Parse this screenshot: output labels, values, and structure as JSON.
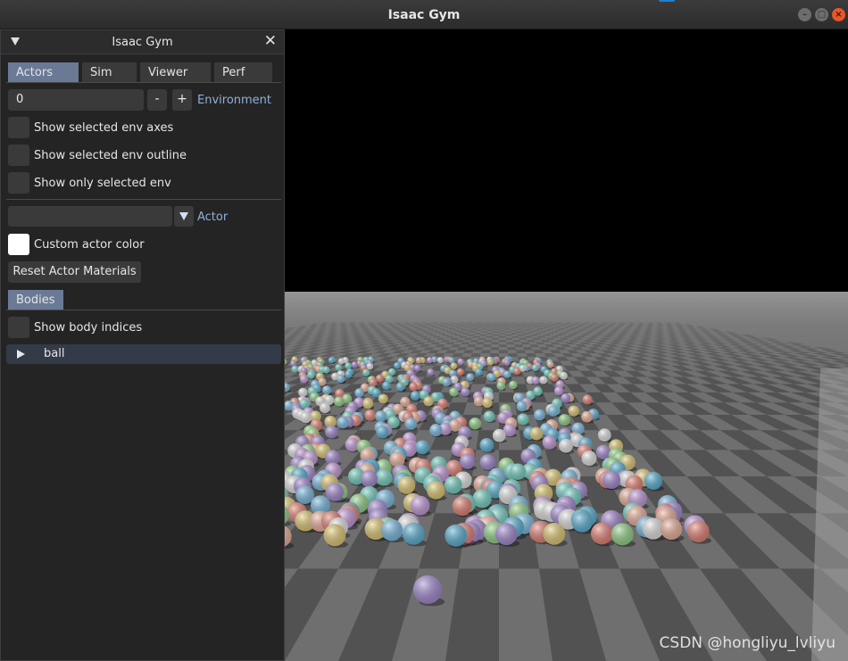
{
  "window": {
    "title": "Isaac Gym"
  },
  "panel": {
    "title": "Isaac Gym",
    "tabs": [
      "Actors",
      "Sim",
      "Viewer",
      "Perf"
    ],
    "environment": {
      "value": "0",
      "minus": "-",
      "plus": "+",
      "label": "Environment"
    },
    "checkboxes": {
      "axes": "Show selected env axes",
      "outline": "Show selected env outline",
      "only": "Show only selected env"
    },
    "actor": {
      "selected": "",
      "label": "Actor"
    },
    "custom_color": "Custom actor color",
    "reset_button": "Reset Actor Materials",
    "bodies_header": "Bodies",
    "show_body_indices": "Show body indices",
    "bodies": [
      {
        "name": "ball"
      }
    ]
  },
  "colors": {
    "tab_active": "#6a7a95",
    "label_blue": "#8fb0d8",
    "close_button": "#e9562a"
  },
  "watermark": "CSDN @hongliyu_lvliyu"
}
